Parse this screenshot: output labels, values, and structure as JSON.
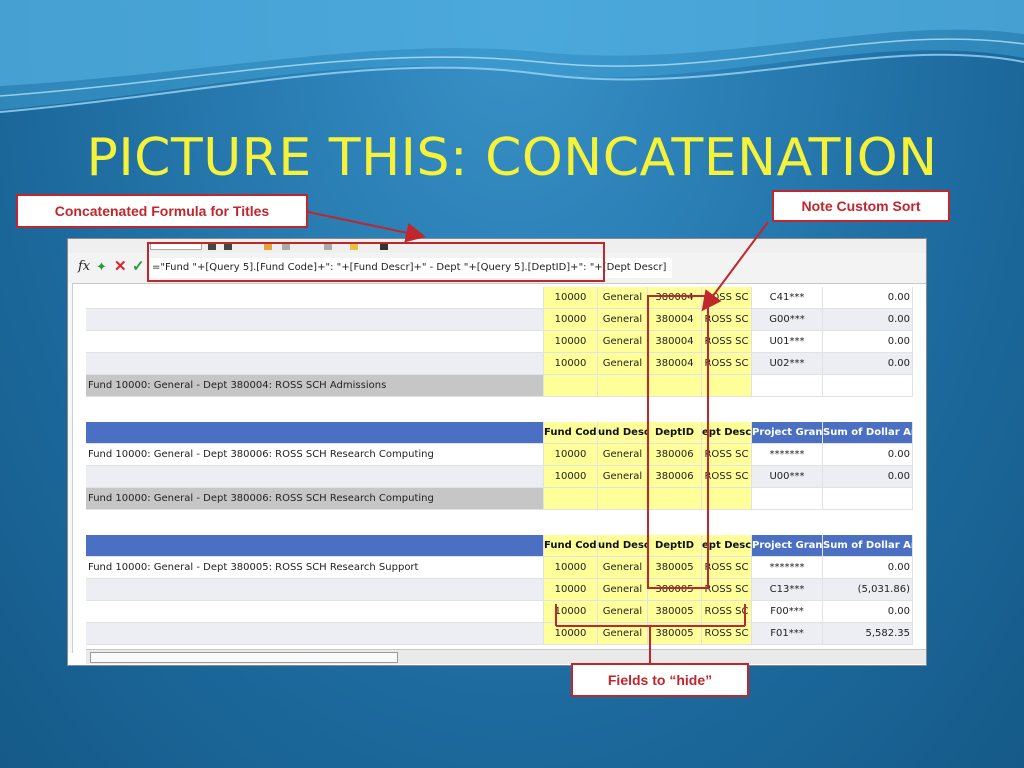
{
  "slide": {
    "title": "PICTURE THIS: CONCATENATION",
    "callouts": {
      "formula": "Concatenated Formula for Titles",
      "sort": "Note Custom Sort",
      "hide": "Fields to “hide”"
    }
  },
  "formula_bar": {
    "fx_icon": "fx-icon",
    "formula": "=\"Fund \"+[Query 5].[Fund Code]+\": \"+[Fund Descr]+\" - Dept \"+[Query 5].[DeptID]+\": \"+[Dept Descr]"
  },
  "table": {
    "headers": [
      "Fund Code",
      "und Descr",
      "DeptID",
      "ept Descr",
      "Project Grant",
      "Sum of Dollar Amo"
    ],
    "rows": [
      {
        "type": "data",
        "title": "",
        "cells": [
          "10000",
          "General",
          "380004",
          "ROSS SC",
          "C41***",
          "0.00"
        ]
      },
      {
        "type": "data",
        "title": "",
        "cells": [
          "10000",
          "General",
          "380004",
          "ROSS SC",
          "G00***",
          "0.00"
        ]
      },
      {
        "type": "data",
        "title": "",
        "cells": [
          "10000",
          "General",
          "380004",
          "ROSS SC",
          "U01***",
          "0.00"
        ]
      },
      {
        "type": "data",
        "title": "",
        "cells": [
          "10000",
          "General",
          "380004",
          "ROSS SC",
          "U02***",
          "0.00"
        ]
      },
      {
        "type": "subtotal",
        "title": "Fund 10000: General - Dept 380004: ROSS SCH Admissions",
        "cells": [
          "",
          "",
          "",
          "",
          "",
          ""
        ]
      },
      {
        "type": "header",
        "title": "",
        "cells": [
          "Fund Code",
          "und Descr",
          "DeptID",
          "ept Descr",
          "Project Grant",
          "Sum of Dollar Amo"
        ]
      },
      {
        "type": "data",
        "title": "Fund 10000: General - Dept 380006: ROSS SCH Research Computing",
        "cells": [
          "10000",
          "General",
          "380006",
          "ROSS SC",
          "*******",
          "0.00"
        ]
      },
      {
        "type": "data",
        "title": "",
        "cells": [
          "10000",
          "General",
          "380006",
          "ROSS SC",
          "U00***",
          "0.00"
        ]
      },
      {
        "type": "subtotal",
        "title": "Fund 10000: General - Dept 380006: ROSS SCH Research Computing",
        "cells": [
          "",
          "",
          "",
          "",
          "",
          ""
        ]
      },
      {
        "type": "header",
        "title": "",
        "cells": [
          "Fund Code",
          "und Descr",
          "DeptID",
          "ept Descr",
          "Project Grant",
          "Sum of Dollar Amo"
        ]
      },
      {
        "type": "data",
        "title": "Fund 10000: General - Dept 380005: ROSS SCH Research Support",
        "cells": [
          "10000",
          "General",
          "380005",
          "ROSS SC",
          "*******",
          "0.00"
        ]
      },
      {
        "type": "data",
        "title": "",
        "cells": [
          "10000",
          "General",
          "380005",
          "ROSS SC",
          "C13***",
          "(5,031.86)"
        ]
      },
      {
        "type": "data",
        "title": "",
        "cells": [
          "10000",
          "General",
          "380005",
          "ROSS SC",
          "F00***",
          "0.00"
        ]
      },
      {
        "type": "data",
        "title": "",
        "cells": [
          "10000",
          "General",
          "380005",
          "ROSS SC",
          "F01***",
          "5,582.35"
        ]
      }
    ]
  },
  "colors": {
    "title": "#f6f23a",
    "callout_red": "#c0262b",
    "header_blue": "#4b70c3",
    "highlight_yellow": "#ffff9a",
    "subtotal_gray": "#c6c6c6"
  }
}
